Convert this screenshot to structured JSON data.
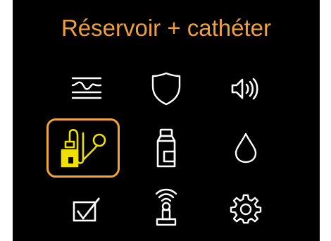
{
  "screen": {
    "title": "Réservoir + cathéter",
    "title_color": "#f0a039",
    "icon_color": "#ffffff",
    "selected_color": "#f0a532",
    "selected_icon_color": "#f0e000"
  },
  "menu": {
    "items": [
      {
        "icon": "trend-graph-icon",
        "selected": false
      },
      {
        "icon": "shield-icon",
        "selected": false
      },
      {
        "icon": "speaker-volume-icon",
        "selected": false
      },
      {
        "icon": "reservoir-catheter-icon",
        "selected": true
      },
      {
        "icon": "cartridge-icon",
        "selected": false
      },
      {
        "icon": "drop-icon",
        "selected": false
      },
      {
        "icon": "checkbox-icon",
        "selected": false
      },
      {
        "icon": "wireless-device-icon",
        "selected": false
      },
      {
        "icon": "gear-icon",
        "selected": false
      }
    ]
  }
}
